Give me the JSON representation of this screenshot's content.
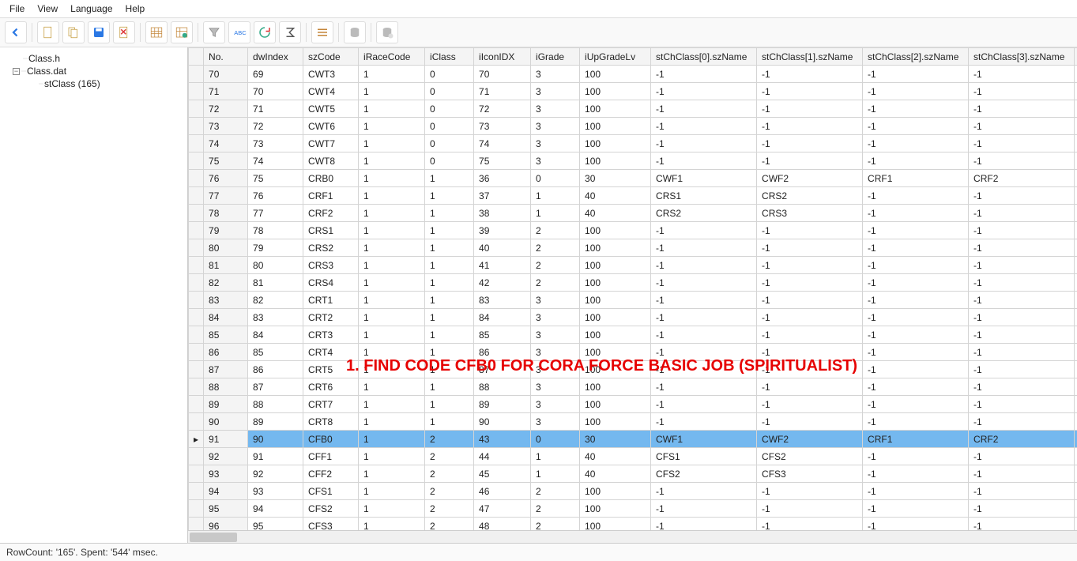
{
  "menu": {
    "items": [
      "File",
      "View",
      "Language",
      "Help"
    ]
  },
  "toolbar_icons": [
    "back",
    "doc-new",
    "doc-dup",
    "save",
    "doc-del",
    "table",
    "table-edit",
    "filter",
    "abc-filter",
    "refresh",
    "sigma",
    "lines",
    "db1",
    "db2"
  ],
  "tree": {
    "items": [
      {
        "label": "Class.h",
        "level": 1,
        "toggle": ""
      },
      {
        "label": "Class.dat",
        "level": 1,
        "toggle": "−"
      },
      {
        "label": "stClass (165)",
        "level": 2,
        "toggle": ""
      }
    ]
  },
  "grid": {
    "columns": [
      "No.",
      "dwIndex",
      "szCode",
      "iRaceCode",
      "iClass",
      "iIconIDX",
      "iGrade",
      "iUpGradeLv",
      "stChClass[0].szName",
      "stChClass[1].szName",
      "stChClass[2].szName",
      "stChClass[3].szName"
    ],
    "selected_row_no": 91,
    "rows": [
      {
        "no": 70,
        "dw": "69",
        "sz": "CWT3",
        "rc": "1",
        "cl": "0",
        "ic": "70",
        "gr": "3",
        "up": "100",
        "c0": "-1",
        "c1": "-1",
        "c2": "-1",
        "c3": "-1"
      },
      {
        "no": 71,
        "dw": "70",
        "sz": "CWT4",
        "rc": "1",
        "cl": "0",
        "ic": "71",
        "gr": "3",
        "up": "100",
        "c0": "-1",
        "c1": "-1",
        "c2": "-1",
        "c3": "-1"
      },
      {
        "no": 72,
        "dw": "71",
        "sz": "CWT5",
        "rc": "1",
        "cl": "0",
        "ic": "72",
        "gr": "3",
        "up": "100",
        "c0": "-1",
        "c1": "-1",
        "c2": "-1",
        "c3": "-1"
      },
      {
        "no": 73,
        "dw": "72",
        "sz": "CWT6",
        "rc": "1",
        "cl": "0",
        "ic": "73",
        "gr": "3",
        "up": "100",
        "c0": "-1",
        "c1": "-1",
        "c2": "-1",
        "c3": "-1"
      },
      {
        "no": 74,
        "dw": "73",
        "sz": "CWT7",
        "rc": "1",
        "cl": "0",
        "ic": "74",
        "gr": "3",
        "up": "100",
        "c0": "-1",
        "c1": "-1",
        "c2": "-1",
        "c3": "-1"
      },
      {
        "no": 75,
        "dw": "74",
        "sz": "CWT8",
        "rc": "1",
        "cl": "0",
        "ic": "75",
        "gr": "3",
        "up": "100",
        "c0": "-1",
        "c1": "-1",
        "c2": "-1",
        "c3": "-1"
      },
      {
        "no": 76,
        "dw": "75",
        "sz": "CRB0",
        "rc": "1",
        "cl": "1",
        "ic": "36",
        "gr": "0",
        "up": "30",
        "c0": "CWF1",
        "c1": "CWF2",
        "c2": "CRF1",
        "c3": "CRF2"
      },
      {
        "no": 77,
        "dw": "76",
        "sz": "CRF1",
        "rc": "1",
        "cl": "1",
        "ic": "37",
        "gr": "1",
        "up": "40",
        "c0": "CRS1",
        "c1": "CRS2",
        "c2": "-1",
        "c3": "-1"
      },
      {
        "no": 78,
        "dw": "77",
        "sz": "CRF2",
        "rc": "1",
        "cl": "1",
        "ic": "38",
        "gr": "1",
        "up": "40",
        "c0": "CRS2",
        "c1": "CRS3",
        "c2": "-1",
        "c3": "-1"
      },
      {
        "no": 79,
        "dw": "78",
        "sz": "CRS1",
        "rc": "1",
        "cl": "1",
        "ic": "39",
        "gr": "2",
        "up": "100",
        "c0": "-1",
        "c1": "-1",
        "c2": "-1",
        "c3": "-1"
      },
      {
        "no": 80,
        "dw": "79",
        "sz": "CRS2",
        "rc": "1",
        "cl": "1",
        "ic": "40",
        "gr": "2",
        "up": "100",
        "c0": "-1",
        "c1": "-1",
        "c2": "-1",
        "c3": "-1"
      },
      {
        "no": 81,
        "dw": "80",
        "sz": "CRS3",
        "rc": "1",
        "cl": "1",
        "ic": "41",
        "gr": "2",
        "up": "100",
        "c0": "-1",
        "c1": "-1",
        "c2": "-1",
        "c3": "-1"
      },
      {
        "no": 82,
        "dw": "81",
        "sz": "CRS4",
        "rc": "1",
        "cl": "1",
        "ic": "42",
        "gr": "2",
        "up": "100",
        "c0": "-1",
        "c1": "-1",
        "c2": "-1",
        "c3": "-1"
      },
      {
        "no": 83,
        "dw": "82",
        "sz": "CRT1",
        "rc": "1",
        "cl": "1",
        "ic": "83",
        "gr": "3",
        "up": "100",
        "c0": "-1",
        "c1": "-1",
        "c2": "-1",
        "c3": "-1"
      },
      {
        "no": 84,
        "dw": "83",
        "sz": "CRT2",
        "rc": "1",
        "cl": "1",
        "ic": "84",
        "gr": "3",
        "up": "100",
        "c0": "-1",
        "c1": "-1",
        "c2": "-1",
        "c3": "-1"
      },
      {
        "no": 85,
        "dw": "84",
        "sz": "CRT3",
        "rc": "1",
        "cl": "1",
        "ic": "85",
        "gr": "3",
        "up": "100",
        "c0": "-1",
        "c1": "-1",
        "c2": "-1",
        "c3": "-1"
      },
      {
        "no": 86,
        "dw": "85",
        "sz": "CRT4",
        "rc": "1",
        "cl": "1",
        "ic": "86",
        "gr": "3",
        "up": "100",
        "c0": "-1",
        "c1": "-1",
        "c2": "-1",
        "c3": "-1"
      },
      {
        "no": 87,
        "dw": "86",
        "sz": "CRT5",
        "rc": "1",
        "cl": "1",
        "ic": "87",
        "gr": "3",
        "up": "100",
        "c0": "-1",
        "c1": "-1",
        "c2": "-1",
        "c3": "-1"
      },
      {
        "no": 88,
        "dw": "87",
        "sz": "CRT6",
        "rc": "1",
        "cl": "1",
        "ic": "88",
        "gr": "3",
        "up": "100",
        "c0": "-1",
        "c1": "-1",
        "c2": "-1",
        "c3": "-1"
      },
      {
        "no": 89,
        "dw": "88",
        "sz": "CRT7",
        "rc": "1",
        "cl": "1",
        "ic": "89",
        "gr": "3",
        "up": "100",
        "c0": "-1",
        "c1": "-1",
        "c2": "-1",
        "c3": "-1"
      },
      {
        "no": 90,
        "dw": "89",
        "sz": "CRT8",
        "rc": "1",
        "cl": "1",
        "ic": "90",
        "gr": "3",
        "up": "100",
        "c0": "-1",
        "c1": "-1",
        "c2": "-1",
        "c3": "-1"
      },
      {
        "no": 91,
        "dw": "90",
        "sz": "CFB0",
        "rc": "1",
        "cl": "2",
        "ic": "43",
        "gr": "0",
        "up": "30",
        "c0": "CWF1",
        "c1": "CWF2",
        "c2": "CRF1",
        "c3": "CRF2"
      },
      {
        "no": 92,
        "dw": "91",
        "sz": "CFF1",
        "rc": "1",
        "cl": "2",
        "ic": "44",
        "gr": "1",
        "up": "40",
        "c0": "CFS1",
        "c1": "CFS2",
        "c2": "-1",
        "c3": "-1"
      },
      {
        "no": 93,
        "dw": "92",
        "sz": "CFF2",
        "rc": "1",
        "cl": "2",
        "ic": "45",
        "gr": "1",
        "up": "40",
        "c0": "CFS2",
        "c1": "CFS3",
        "c2": "-1",
        "c3": "-1"
      },
      {
        "no": 94,
        "dw": "93",
        "sz": "CFS1",
        "rc": "1",
        "cl": "2",
        "ic": "46",
        "gr": "2",
        "up": "100",
        "c0": "-1",
        "c1": "-1",
        "c2": "-1",
        "c3": "-1"
      },
      {
        "no": 95,
        "dw": "94",
        "sz": "CFS2",
        "rc": "1",
        "cl": "2",
        "ic": "47",
        "gr": "2",
        "up": "100",
        "c0": "-1",
        "c1": "-1",
        "c2": "-1",
        "c3": "-1"
      },
      {
        "no": 96,
        "dw": "95",
        "sz": "CFS3",
        "rc": "1",
        "cl": "2",
        "ic": "48",
        "gr": "2",
        "up": "100",
        "c0": "-1",
        "c1": "-1",
        "c2": "-1",
        "c3": "-1"
      }
    ]
  },
  "annotation": {
    "text": "1. FIND CODE CFB0 FOR CORA FORCE BASIC JOB (SPIRITUALIST)"
  },
  "status": {
    "text": "RowCount: '165'. Spent: '544' msec."
  }
}
